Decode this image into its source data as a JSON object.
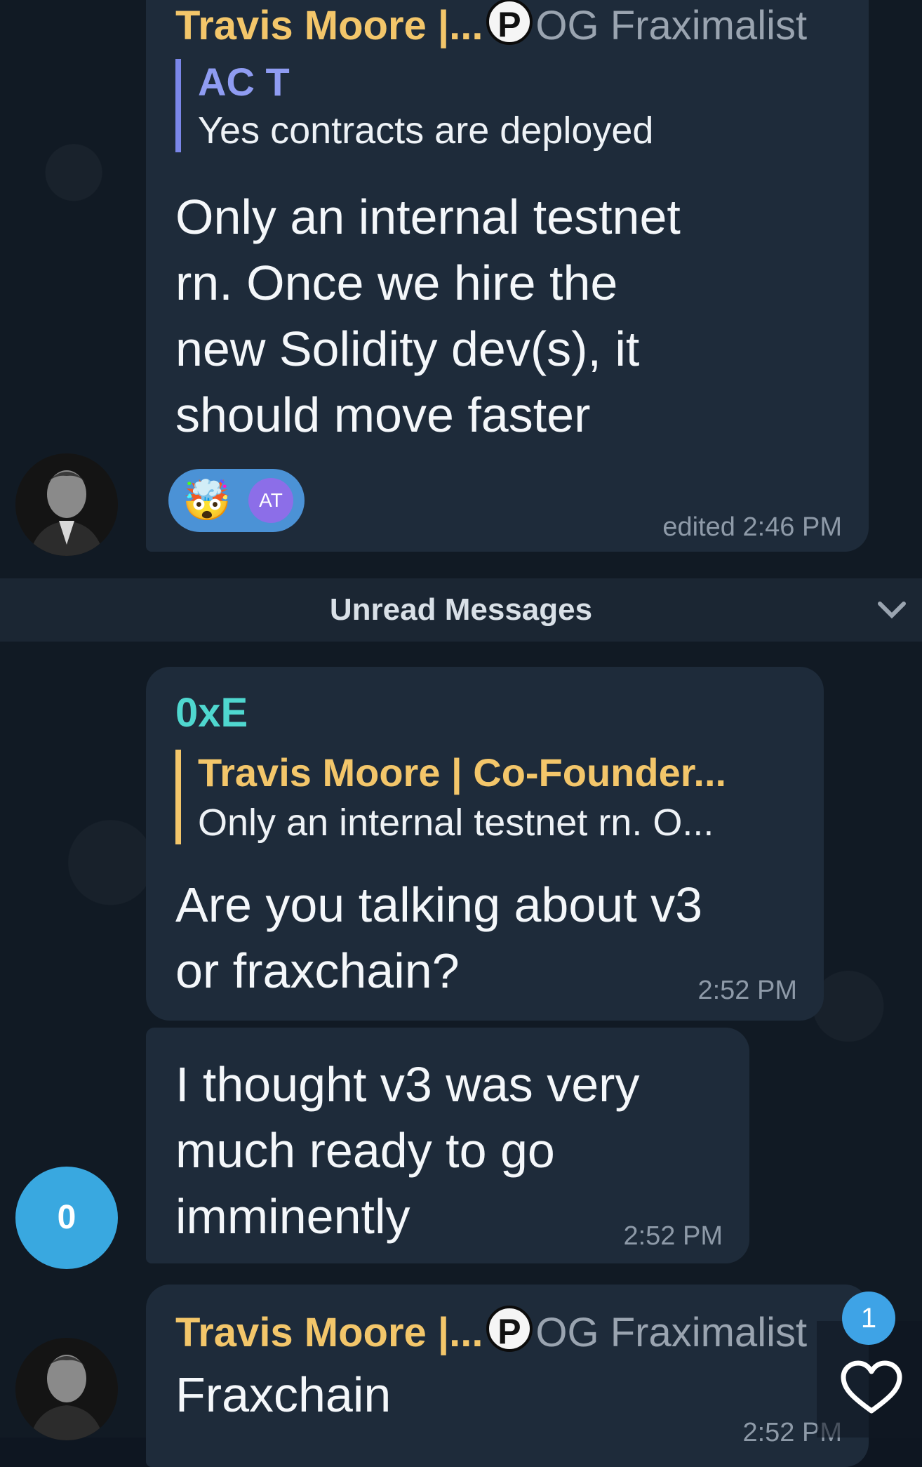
{
  "messages": {
    "m1": {
      "sender": "Travis Moore |...",
      "badge_letter": "P",
      "title": "OG Fraximalist",
      "reply_name": "AC T",
      "reply_text": "Yes contracts are deployed",
      "lines": [
        "Only an internal testnet",
        "rn. Once we hire the",
        "new Solidity dev(s), it",
        "should move faster"
      ],
      "reaction_emoji": "🤯",
      "reaction_user": "AT",
      "time": "edited 2:46 PM"
    },
    "unread_label": "Unread Messages",
    "m2": {
      "sender": "0xE",
      "reply_name": "Travis Moore | Co-Founder...",
      "reply_text": "Only an internal testnet rn. O...",
      "lines": [
        "Are you talking about v3",
        "or fraxchain?"
      ],
      "time": "2:52 PM"
    },
    "m3": {
      "lines": [
        "I thought v3 was very",
        "much ready to go",
        "imminently"
      ],
      "time": "2:52 PM",
      "avatar_letter": "0"
    },
    "m4": {
      "sender": "Travis Moore |...",
      "badge_letter": "P",
      "title": "OG Fraximalist",
      "text": "Fraxchain",
      "time": "2:52 PM",
      "like_count": "1"
    }
  },
  "colors": {
    "gold": "#f3c66a",
    "teal": "#4fd7cf",
    "bubble": "#1e2b3a",
    "avatar_blue": "#39a8e0"
  }
}
